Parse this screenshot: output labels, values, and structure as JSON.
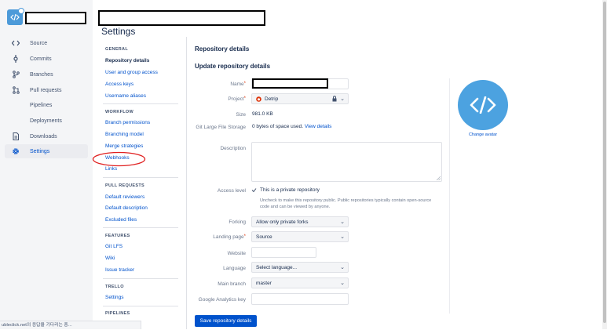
{
  "left_nav": {
    "items": [
      {
        "label": "Source",
        "icon": "code-icon"
      },
      {
        "label": "Commits",
        "icon": "commit-icon"
      },
      {
        "label": "Branches",
        "icon": "branch-icon"
      },
      {
        "label": "Pull requests",
        "icon": "pull-request-icon"
      },
      {
        "label": "Pipelines",
        "icon": "pipelines-icon"
      },
      {
        "label": "Deployments",
        "icon": "deployments-icon"
      },
      {
        "label": "Downloads",
        "icon": "downloads-icon"
      },
      {
        "label": "Settings",
        "icon": "gear-icon"
      }
    ]
  },
  "page_title": "Settings",
  "settings_nav": {
    "general_heading": "GENERAL",
    "general": [
      "Repository details",
      "User and group access",
      "Access keys",
      "Username aliases"
    ],
    "workflow_heading": "WORKFLOW",
    "workflow": [
      "Branch permissions",
      "Branching model",
      "Merge strategies",
      "Webhooks",
      "Links"
    ],
    "pull_requests_heading": "PULL REQUESTS",
    "pull_requests": [
      "Default reviewers",
      "Default description",
      "Excluded files"
    ],
    "features_heading": "FEATURES",
    "features": [
      "Git LFS",
      "Wiki",
      "Issue tracker"
    ],
    "trello_heading": "TRELLO",
    "trello": [
      "Settings"
    ],
    "pipelines_heading": "PIPELINES"
  },
  "form": {
    "section_title": "Repository details",
    "subtitle": "Update repository details",
    "name_label": "Name",
    "project_label": "Project",
    "project_value": "Detrip",
    "size_label": "Size",
    "size_value": "981.0 KB",
    "lfs_label": "Git Large File Storage",
    "lfs_value": "0 bytes of space used.",
    "lfs_link": "View details",
    "description_label": "Description",
    "access_label": "Access level",
    "access_value": "This is a private repository",
    "access_helper": "Uncheck to make this repository public. Public repositories typically contain open-source code and can be viewed by anyone.",
    "forking_label": "Forking",
    "forking_value": "Allow only private forks",
    "landing_label": "Landing page",
    "landing_value": "Source",
    "website_label": "Website",
    "language_label": "Language",
    "language_value": "Select language...",
    "main_branch_label": "Main branch",
    "main_branch_value": "master",
    "ga_label": "Google Analytics key",
    "save_label": "Save repository details"
  },
  "avatar": {
    "change_label": "Change avatar"
  },
  "status_bar": "ubleclick.net의 응답을 기다리는 중..."
}
